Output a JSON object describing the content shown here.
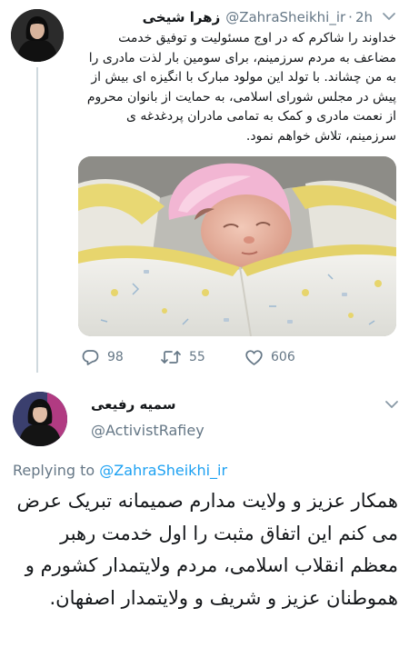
{
  "tweet": {
    "author_name": "زهرا شیخی",
    "handle": "@ZahraSheikhi_ir",
    "separator": "·",
    "time": "2h",
    "text": "خداوند را شاکرم که در اوج مسئولیت و توفیق خدمت مضاعف به مردم سرزمینم، برای سومین بار لذت مادری را به من چشاند. با تولد این مولود مبارک با انگیزه ای بیش از پیش در مجلس شورای اسلامی، به حمایت از بانوان محروم از نعمت مادری و کمک به تمامی مادران پردغدغه ی سرزمینم، تلاش خواهم نمود.",
    "replies": "98",
    "retweets": "55",
    "likes": "606"
  },
  "reply": {
    "author_name": "سمیه رفیعی",
    "handle": "@ActivistRafiey",
    "replying_prefix": "Replying to ",
    "replying_handle": "@ZahraSheikhi_ir",
    "text": "همکار عزیز و ولایت مدارم صمیمانه تبریک عرض می کنم این اتفاق مثبت را اول خدمت رهبر معظم انقلاب اسلامی، مردم ولایتمدار کشورم و هموطنان عزیز و شریف و ولایتمدار اصفهان."
  },
  "icons": {
    "reply": "reply-icon",
    "retweet": "retweet-icon",
    "like": "heart-icon",
    "more": "chevron-down-icon"
  },
  "colors": {
    "text": "#14171a",
    "secondary": "#657786",
    "link": "#1da1f2",
    "thread": "#cfd9de"
  }
}
